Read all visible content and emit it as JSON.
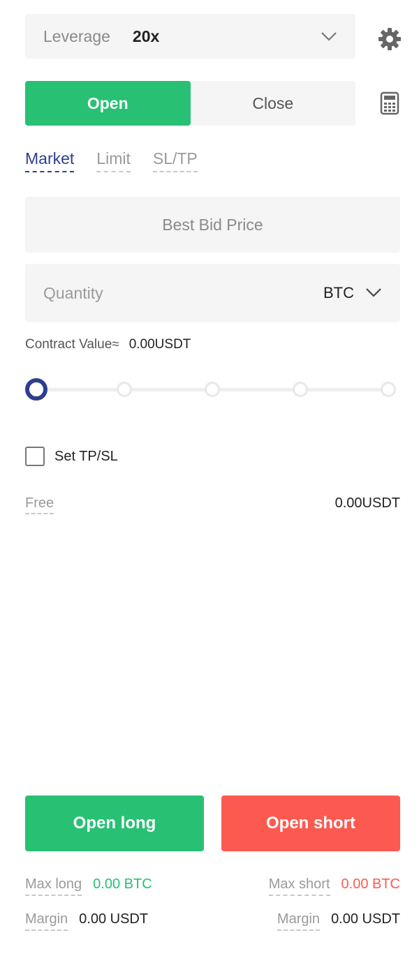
{
  "leverage": {
    "label": "Leverage",
    "value": "20x"
  },
  "colors": {
    "accent_green": "#28c073",
    "accent_red": "#fc5a50",
    "accent_blue": "#2e3f8f"
  },
  "segment": {
    "open_label": "Open",
    "close_label": "Close",
    "selected": "Open"
  },
  "order_types": [
    {
      "label": "Market",
      "active": true
    },
    {
      "label": "Limit",
      "active": false
    },
    {
      "label": "SL/TP",
      "active": false
    }
  ],
  "price": {
    "placeholder": "Best Bid Price"
  },
  "quantity": {
    "placeholder": "Quantity",
    "value": "",
    "unit": "BTC"
  },
  "contract_value": {
    "label": "Contract Value≈",
    "value": "0.00USDT"
  },
  "slider": {
    "percent": 0
  },
  "tpsl": {
    "label": "Set TP/SL",
    "checked": false
  },
  "free": {
    "label": "Free",
    "value": "0.00USDT"
  },
  "actions": {
    "long_label": "Open long",
    "short_label": "Open short"
  },
  "stats": {
    "max_long_label": "Max long",
    "max_long_value": "0.00 BTC",
    "max_short_label": "Max short",
    "max_short_value": "0.00 BTC",
    "margin_long_label": "Margin",
    "margin_long_value": "0.00 USDT",
    "margin_short_label": "Margin",
    "margin_short_value": "0.00 USDT"
  },
  "icons": {
    "leverage_chevron": "chevron-down-icon",
    "settings": "gear-icon",
    "calculator": "calculator-icon",
    "unit_chevron": "chevron-down-icon"
  }
}
